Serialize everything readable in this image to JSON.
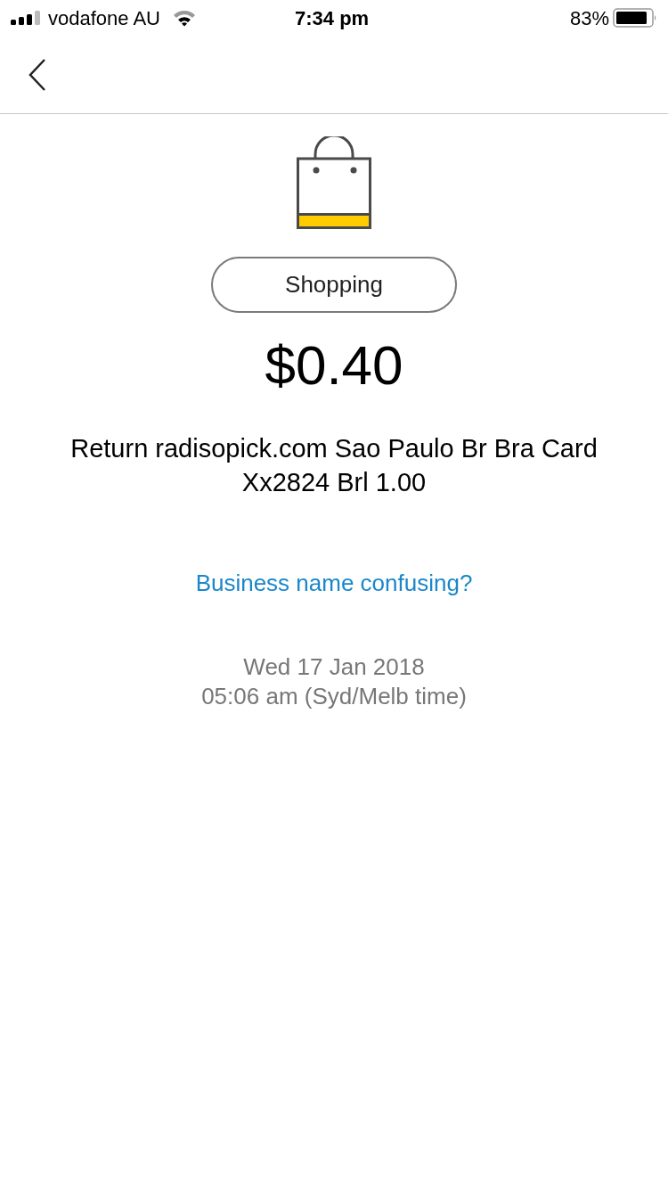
{
  "status_bar": {
    "carrier": "vodafone AU",
    "time": "7:34 pm",
    "battery": "83%"
  },
  "transaction": {
    "category": "Shopping",
    "amount": "$0.40",
    "description": "Return radisopick.com Sao Paulo Br Bra Card Xx2824 Brl 1.00",
    "help_link": "Business name confusing?",
    "date": "Wed 17 Jan 2018",
    "time": "05:06 am (Syd/Melb time)"
  }
}
